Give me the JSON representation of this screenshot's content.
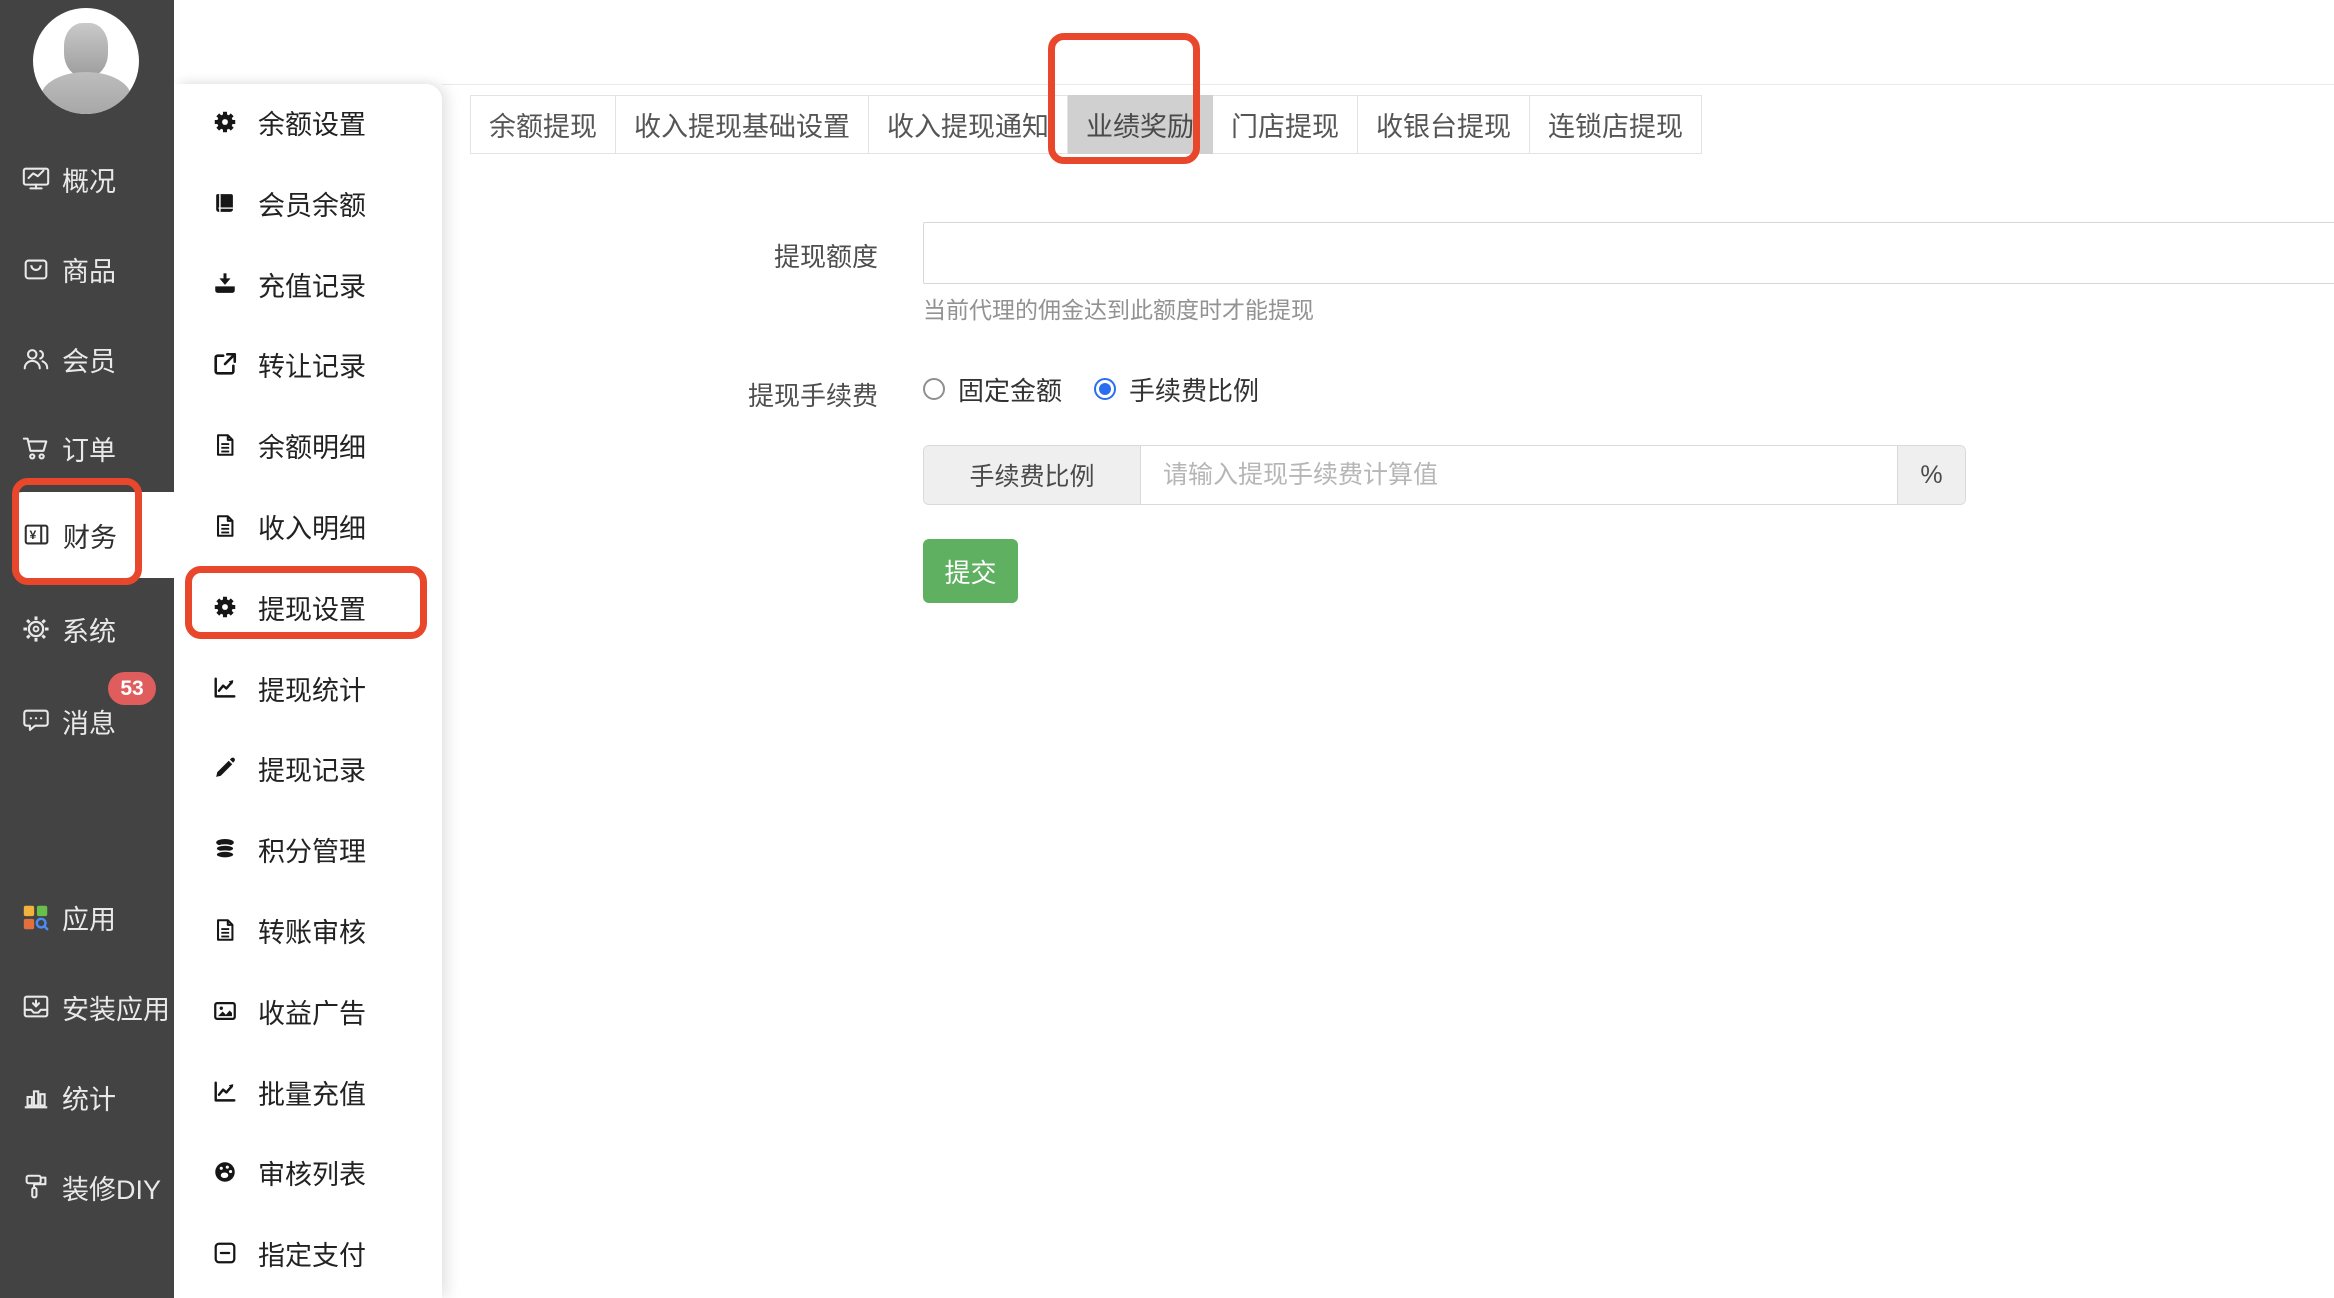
{
  "colors": {
    "sidebar_bg": "#434343",
    "annotation": "#e8472c",
    "accent_green": "#5fb061",
    "radio_blue": "#2a6ef0",
    "badge_red": "#e05d5d",
    "active_tab_bg": "#d0d0d0"
  },
  "sidebar": {
    "items": [
      {
        "label": "概况",
        "icon": "overview-icon"
      },
      {
        "label": "商品",
        "icon": "goods-icon"
      },
      {
        "label": "会员",
        "icon": "members-icon"
      },
      {
        "label": "订单",
        "icon": "orders-icon"
      },
      {
        "label": "财务",
        "icon": "finance-icon",
        "active": true,
        "annotated": true
      },
      {
        "label": "系统",
        "icon": "system-icon"
      },
      {
        "label": "消息",
        "icon": "message-icon",
        "badge": "53"
      },
      {
        "label": "应用",
        "icon": "apps-icon"
      },
      {
        "label": "安装应用",
        "icon": "install-icon"
      },
      {
        "label": "统计",
        "icon": "stats-icon"
      },
      {
        "label": "装修DIY",
        "icon": "diy-icon"
      }
    ]
  },
  "menu": {
    "items": [
      {
        "label": "余额设置",
        "icon": "gear-icon"
      },
      {
        "label": "会员余额",
        "icon": "book-icon"
      },
      {
        "label": "充值记录",
        "icon": "download-icon"
      },
      {
        "label": "转让记录",
        "icon": "transfer-icon"
      },
      {
        "label": "余额明细",
        "icon": "file-icon"
      },
      {
        "label": "收入明细",
        "icon": "file-icon"
      },
      {
        "label": "提现设置",
        "icon": "gear-icon",
        "annotated": true
      },
      {
        "label": "提现统计",
        "icon": "chart-icon"
      },
      {
        "label": "提现记录",
        "icon": "pencil-icon"
      },
      {
        "label": "积分管理",
        "icon": "points-icon"
      },
      {
        "label": "转账审核",
        "icon": "file-icon"
      },
      {
        "label": "收益广告",
        "icon": "ad-icon"
      },
      {
        "label": "批量充值",
        "icon": "chart-icon"
      },
      {
        "label": "审核列表",
        "icon": "audit-icon"
      },
      {
        "label": "指定支付",
        "icon": "pay-icon"
      }
    ]
  },
  "tabs": {
    "items": [
      {
        "label": "余额提现"
      },
      {
        "label": "收入提现基础设置"
      },
      {
        "label": "收入提现通知"
      },
      {
        "label": "业绩奖励",
        "active": true,
        "annotated": true
      },
      {
        "label": "门店提现"
      },
      {
        "label": "收银台提现"
      },
      {
        "label": "连锁店提现"
      }
    ]
  },
  "form": {
    "quota_label": "提现额度",
    "quota_value": "",
    "quota_hint": "当前代理的佣金达到此额度时才能提现",
    "fee_label": "提现手续费",
    "fee_options": [
      {
        "label": "固定金额",
        "selected": false
      },
      {
        "label": "手续费比例",
        "selected": true
      }
    ],
    "rate_addon": "手续费比例",
    "rate_placeholder": "请输入提现手续费计算值",
    "rate_suffix": "%",
    "submit_label": "提交"
  }
}
